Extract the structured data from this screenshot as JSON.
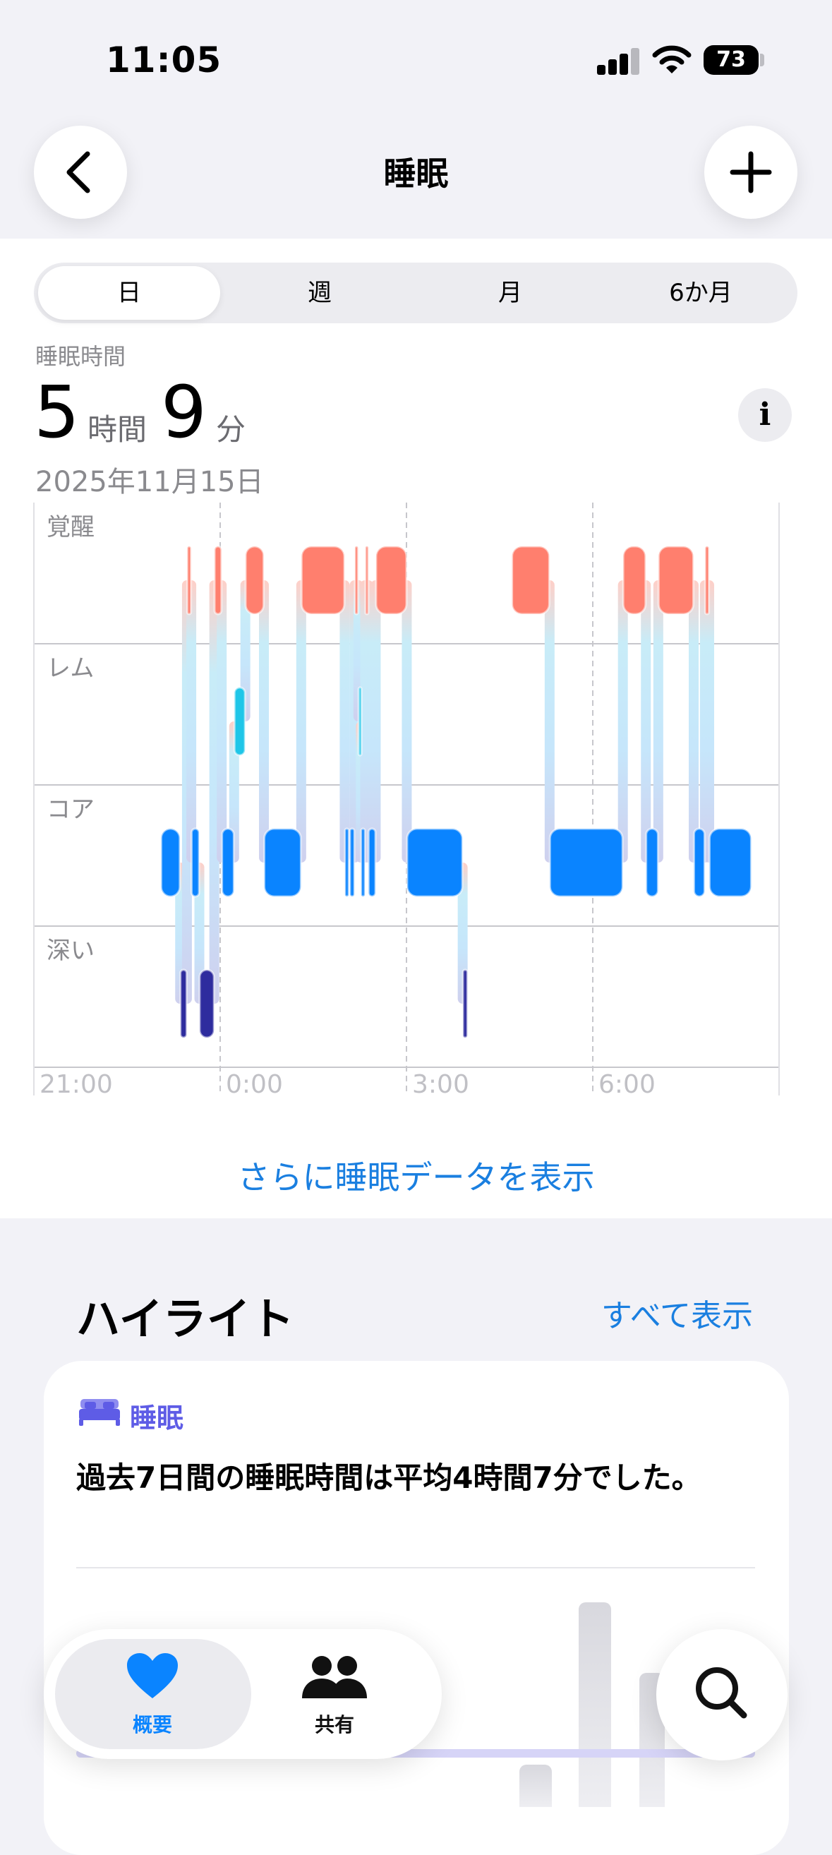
{
  "status_bar": {
    "time": "11:05",
    "battery": "73"
  },
  "nav": {
    "title": "睡眠"
  },
  "segments": {
    "items": [
      "日",
      "週",
      "月",
      "6か月"
    ],
    "selected": "日"
  },
  "summary": {
    "label": "睡眠時間",
    "hours": "5",
    "hours_unit": "時間",
    "minutes": "9",
    "minutes_unit": "分",
    "date": "2025年11月15日",
    "info_label": "i"
  },
  "chart_data": {
    "type": "sleep-stage-timeline",
    "stages": [
      "覚醒",
      "レム",
      "コア",
      "深い"
    ],
    "x_ticks": [
      "21:00",
      "0:00",
      "3:00",
      "6:00"
    ],
    "x_range_hours": [
      21,
      33
    ],
    "segments": [
      {
        "stage": "コア",
        "start": 23.05,
        "end": 23.35
      },
      {
        "stage": "深い",
        "start": 23.36,
        "end": 23.46
      },
      {
        "stage": "覚醒",
        "start": 23.47,
        "end": 23.53
      },
      {
        "stage": "コア",
        "start": 23.54,
        "end": 23.66
      },
      {
        "stage": "深い",
        "start": 23.67,
        "end": 23.9
      },
      {
        "stage": "覚醒",
        "start": 23.91,
        "end": 24.02
      },
      {
        "stage": "コア",
        "start": 24.03,
        "end": 24.22
      },
      {
        "stage": "レム",
        "start": 24.23,
        "end": 24.4
      },
      {
        "stage": "覚醒",
        "start": 24.41,
        "end": 24.7
      },
      {
        "stage": "コア",
        "start": 24.71,
        "end": 25.3
      },
      {
        "stage": "覚醒",
        "start": 25.31,
        "end": 26.0
      },
      {
        "stage": "コア",
        "start": 26.01,
        "end": 26.07
      },
      {
        "stage": "コア",
        "start": 26.09,
        "end": 26.16
      },
      {
        "stage": "覚醒",
        "start": 26.17,
        "end": 26.22
      },
      {
        "stage": "レム",
        "start": 26.23,
        "end": 26.26
      },
      {
        "stage": "コア",
        "start": 26.27,
        "end": 26.33
      },
      {
        "stage": "覚醒",
        "start": 26.34,
        "end": 26.38
      },
      {
        "stage": "コア",
        "start": 26.39,
        "end": 26.5
      },
      {
        "stage": "覚醒",
        "start": 26.51,
        "end": 27.0
      },
      {
        "stage": "コア",
        "start": 27.01,
        "end": 27.9
      },
      {
        "stage": "深い",
        "start": 27.91,
        "end": 27.98
      },
      {
        "stage": "覚醒",
        "start": 28.7,
        "end": 29.3
      },
      {
        "stage": "コア",
        "start": 29.31,
        "end": 30.48
      },
      {
        "stage": "覚醒",
        "start": 30.49,
        "end": 30.85
      },
      {
        "stage": "コア",
        "start": 30.86,
        "end": 31.05
      },
      {
        "stage": "覚醒",
        "start": 31.06,
        "end": 31.62
      },
      {
        "stage": "コア",
        "start": 31.63,
        "end": 31.8
      },
      {
        "stage": "覚醒",
        "start": 31.81,
        "end": 31.87
      },
      {
        "stage": "コア",
        "start": 31.88,
        "end": 32.55
      }
    ]
  },
  "more_link": "さらに睡眠データを表示",
  "highlights": {
    "title": "ハイライト",
    "show_all": "すべて表示",
    "card": {
      "category": "睡眠",
      "text": "過去7日間の睡眠時間は平均4時間7分でした。"
    }
  },
  "tabbar": {
    "items": [
      {
        "label": "概要",
        "icon": "heart-icon"
      },
      {
        "label": "共有",
        "icon": "people-icon"
      }
    ]
  },
  "colors": {
    "awake": "#ff7f6e",
    "rem": "#1fc6e8",
    "core": "#0a84ff",
    "deep": "#2e2c9e",
    "link": "#1a7fe0"
  }
}
